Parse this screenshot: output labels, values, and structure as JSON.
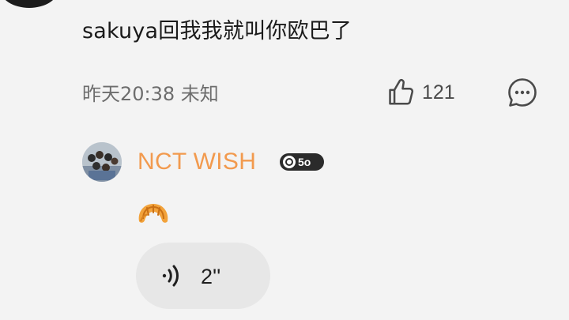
{
  "comment": {
    "text": "sakuya回我我就叫你欧巴了",
    "meta": "昨天20:38 未知",
    "like_count": "121",
    "icons": {
      "like": "thumbs-up-icon",
      "reply": "chat-bubble-icon"
    }
  },
  "reply": {
    "author": "NCT WISH",
    "author_color": "#f29a4e",
    "level_badge": "5o",
    "emoji": "croissant",
    "voice_duration": "2''"
  }
}
